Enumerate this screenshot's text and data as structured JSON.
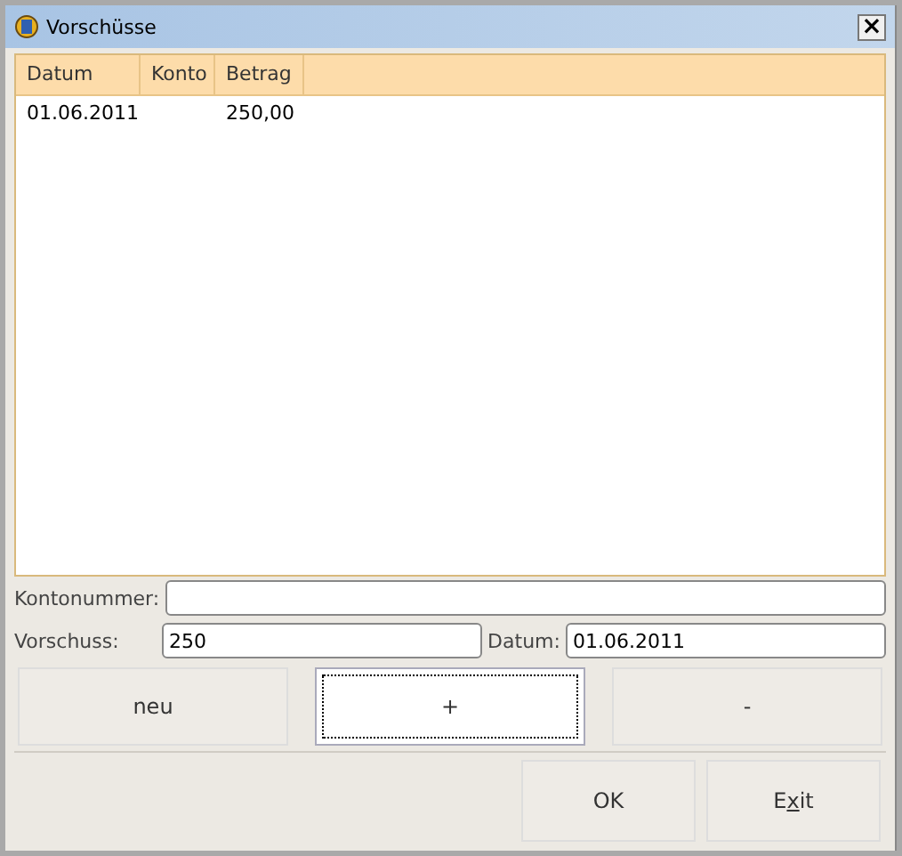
{
  "window": {
    "title": "Vorschüsse",
    "close": "×"
  },
  "table": {
    "columns": [
      "Datum",
      "Konto",
      "Betrag"
    ],
    "rows": [
      {
        "cells": [
          "01.06.2011",
          null,
          "250,00"
        ],
        "selected": false
      }
    ]
  },
  "fields": [
    {
      "label": "Kontonummer:"
    }
  ],
  "field_row": [
    {
      "label": "Vorschuss:",
      "value": "250"
    },
    {
      "label": "Datum:",
      "value": "01.06.2011"
    }
  ],
  "actions": [
    {
      "label": "neu",
      "focused": false
    },
    {
      "label": "+",
      "focused": true
    },
    {
      "label": "-",
      "focused": false
    }
  ],
  "buttons": [
    {
      "parts": [
        {
          "text": "OK",
          "underlined": false
        }
      ]
    },
    {
      "parts": [
        {
          "text": "E",
          "underlined": false
        },
        {
          "text": "x",
          "underlined": true
        },
        {
          "text": "it",
          "underlined": false
        }
      ]
    }
  ]
}
